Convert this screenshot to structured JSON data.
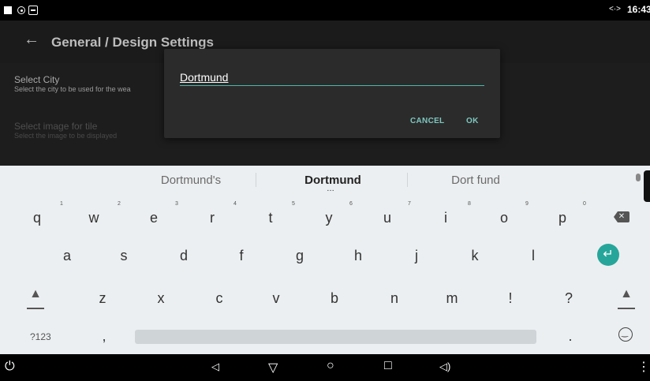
{
  "status_bar": {
    "time": "16:43",
    "code_icon": "<·>"
  },
  "app_bar": {
    "title": "General / Design Settings",
    "back_icon": "arrow-back-icon"
  },
  "settings": [
    {
      "title": "Select City",
      "subtitle": "Select the city to be used for the wea"
    },
    {
      "title": "Select image for tile",
      "subtitle": "Select the image to be displayed"
    }
  ],
  "dialog": {
    "input_value": "Dortmund",
    "cancel_label": "CANCEL",
    "ok_label": "OK",
    "accent_color": "#4db6ac"
  },
  "keyboard": {
    "suggestions": [
      "Dortmund's",
      "Dortmund",
      "Dort fund"
    ],
    "suggestion_more": "…",
    "row1": [
      "q",
      "w",
      "e",
      "r",
      "t",
      "y",
      "u",
      "i",
      "o",
      "p"
    ],
    "row1_hints": [
      "1",
      "2",
      "3",
      "4",
      "5",
      "6",
      "7",
      "8",
      "9",
      "0"
    ],
    "row2": [
      "a",
      "s",
      "d",
      "f",
      "g",
      "h",
      "j",
      "k",
      "l"
    ],
    "row3": [
      "z",
      "x",
      "c",
      "v",
      "b",
      "n",
      "m",
      "!",
      "?"
    ],
    "symbols_label": "?123",
    "comma": ",",
    "period": ".",
    "enter_color": "#26a69a"
  }
}
